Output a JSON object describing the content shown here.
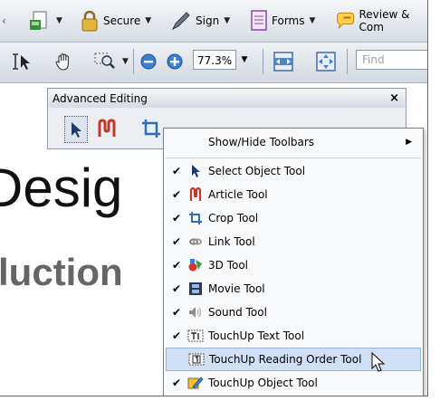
{
  "toolbar_top": {
    "secure": "Secure",
    "sign": "Sign",
    "forms": "Forms",
    "review": "Review & Com"
  },
  "toolbar_nav": {
    "zoom": "77.3%",
    "find_placeholder": "Find"
  },
  "document": {
    "heading_fragment": "Desig",
    "subheading_fragment": "luction"
  },
  "panel": {
    "title": "Advanced Editing",
    "close": "×"
  },
  "menu": {
    "show_hide": "Show/Hide Toolbars",
    "items": [
      {
        "label": "Select Object Tool",
        "checked": true,
        "icon": "arrow-icon"
      },
      {
        "label": "Article Tool",
        "checked": true,
        "icon": "article-icon"
      },
      {
        "label": "Crop Tool",
        "checked": true,
        "icon": "crop-icon"
      },
      {
        "label": "Link Tool",
        "checked": true,
        "icon": "link-icon"
      },
      {
        "label": "3D Tool",
        "checked": true,
        "icon": "3d-icon"
      },
      {
        "label": "Movie Tool",
        "checked": true,
        "icon": "movie-icon"
      },
      {
        "label": "Sound Tool",
        "checked": true,
        "icon": "sound-icon"
      },
      {
        "label": "TouchUp Text Tool",
        "checked": true,
        "icon": "touchup-text-icon"
      },
      {
        "label": "TouchUp Reading Order Tool",
        "checked": false,
        "icon": "reading-order-icon"
      },
      {
        "label": "TouchUp Object Tool",
        "checked": true,
        "icon": "touchup-object-icon"
      }
    ]
  },
  "symbols": {
    "check": "✔",
    "dropdown": "▼",
    "submenu": "▶"
  }
}
